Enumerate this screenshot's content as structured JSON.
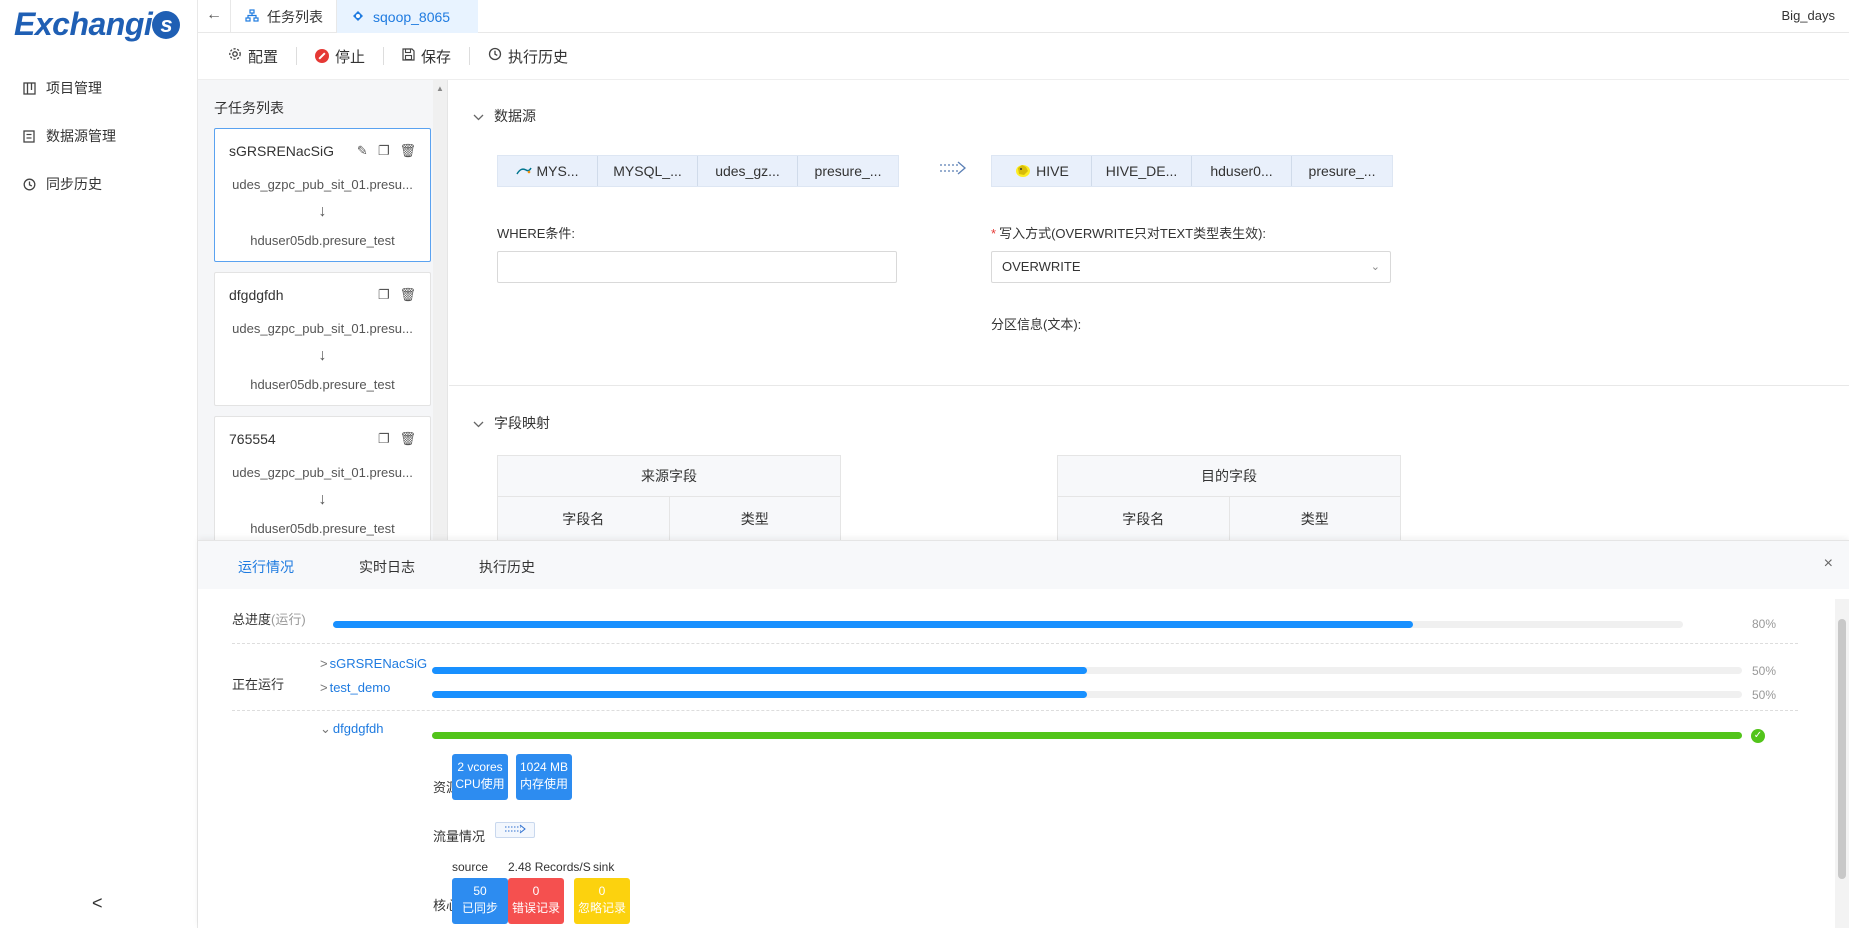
{
  "app": {
    "logo_text": "Exchangis",
    "user": "Big_days"
  },
  "sidebar": {
    "items": [
      {
        "label": "项目管理",
        "icon": "project-icon"
      },
      {
        "label": "数据源管理",
        "icon": "datasource-icon"
      },
      {
        "label": "同步历史",
        "icon": "history-icon"
      }
    ],
    "collapse": "<"
  },
  "topbar": {
    "tabs": [
      {
        "label": "任务列表",
        "icon": "sitemap-icon"
      },
      {
        "label": "sqoop_8065",
        "icon": "sqoop-icon"
      }
    ]
  },
  "toolbar": {
    "config": "配置",
    "stop": "停止",
    "save": "保存",
    "history": "执行历史"
  },
  "subtasks": {
    "title": "子任务列表",
    "items": [
      {
        "name": "sGRSRENacSiG",
        "source": "udes_gzpc_pub_sit_01.presu...",
        "dest": "hduser05db.presure_test"
      },
      {
        "name": "dfgdgfdh",
        "source": "udes_gzpc_pub_sit_01.presu...",
        "dest": "hduser05db.presure_test"
      },
      {
        "name": "765554",
        "source": "udes_gzpc_pub_sit_01.presu...",
        "dest": "hduser05db.presure_test"
      }
    ]
  },
  "datasource": {
    "title": "数据源",
    "source_cells": [
      "MYS...",
      "MYSQL_...",
      "udes_gz...",
      "presure_..."
    ],
    "target_cells": [
      "HIVE",
      "HIVE_DE...",
      "hduser0...",
      "presure_..."
    ],
    "where_label": "WHERE条件:",
    "where_value": "",
    "write_mode_label": "写入方式(OVERWRITE只对TEXT类型表生效):",
    "write_mode_value": "OVERWRITE",
    "partition_label": "分区信息(文本):"
  },
  "field_mapping": {
    "title": "字段映射",
    "source_title": "来源字段",
    "target_title": "目的字段",
    "col_name": "字段名",
    "col_type": "类型"
  },
  "bottom": {
    "tabs": [
      "运行情况",
      "实时日志",
      "执行历史"
    ],
    "close": "×",
    "total_label": "总进度",
    "total_status": "(运行)",
    "total_progress": 0.8,
    "total_pct": "80%",
    "running_label": "正在运行",
    "running_jobs": [
      {
        "name": "sGRSRENacSiG",
        "progress": 0.5,
        "pct": "50%"
      },
      {
        "name": "test_demo",
        "progress": 0.5,
        "pct": "50%"
      }
    ],
    "done_job": {
      "name": "dfgdgfdh",
      "progress": 1.0
    },
    "resource_label": "资源使用",
    "cpu_value": "2 vcores",
    "cpu_label": "CPU使用",
    "mem_value": "1024 MB",
    "mem_label": "内存使用",
    "flow_label": "流量情况",
    "metric_source": "source",
    "metric_rate": "2.48 Records/S",
    "metric_sink": "sink",
    "core_label": "核心指标",
    "synced_value": "50",
    "synced_label": "已同步",
    "error_value": "0",
    "error_label": "错误记录",
    "ignored_value": "0",
    "ignored_label": "忽略记录"
  },
  "colors": {
    "accent": "#1890ff",
    "success": "#52c41a",
    "error": "#f5504f",
    "warning": "#fcd20e",
    "brand": "#1f5fb4"
  }
}
